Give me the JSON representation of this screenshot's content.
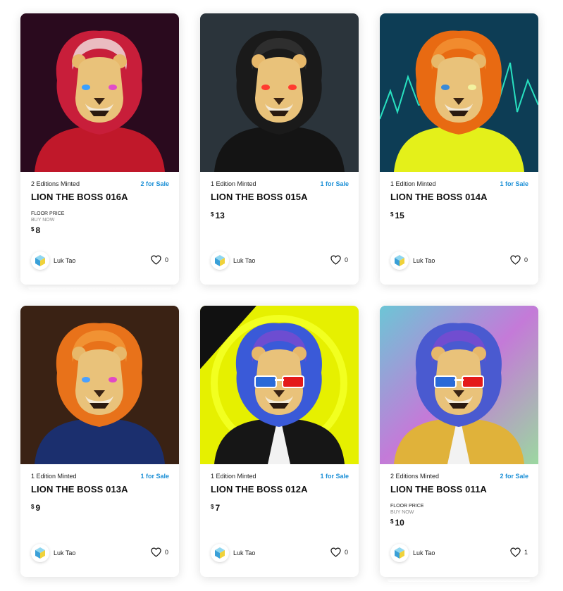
{
  "cards": [
    {
      "editions": "2 Editions Minted",
      "for_sale": "2 for Sale",
      "title": "LION THE BOSS 016A",
      "floor_label": "FLOOR PRICE",
      "buy_label": "BUY NOW",
      "currency": "$",
      "price": "8",
      "creator": "Luk Tao",
      "likes": "0",
      "theme": {
        "bg": "#2a0a1e",
        "mane": "#c81e3a",
        "mane2": "#f2e4e4",
        "suit": "#c0182a",
        "eyeL": "#3aa0ff",
        "eyeR": "#e14cc8"
      }
    },
    {
      "editions": "1 Edition Minted",
      "for_sale": "1 for Sale",
      "title": "LION THE BOSS 015A",
      "currency": "$",
      "price": "13",
      "creator": "Luk Tao",
      "likes": "0",
      "theme": {
        "bg": "#2b343b",
        "mane": "#1a1a1a",
        "mane2": "#333333",
        "suit": "#141414",
        "eyeL": "#ff3b2f",
        "eyeR": "#ff3b2f"
      }
    },
    {
      "editions": "1 Edition Minted",
      "for_sale": "1 for Sale",
      "title": "LION THE BOSS 014A",
      "currency": "$",
      "price": "15",
      "creator": "Luk Tao",
      "likes": "0",
      "theme": {
        "bg": "#0d3d55",
        "mane": "#e86a12",
        "mane2": "#f29436",
        "suit": "#e4f01a",
        "eyeL": "#3a8ad8",
        "eyeR": "#f2f2a0"
      }
    },
    {
      "editions": "1 Edition Minted",
      "for_sale": "1 for Sale",
      "title": "LION THE BOSS 013A",
      "currency": "$",
      "price": "9",
      "creator": "Luk Tao",
      "likes": "0",
      "theme": {
        "bg": "#3a2214",
        "mane": "#e8721a",
        "mane2": "#f39a3a",
        "suit": "#1b2f6e",
        "eyeL": "#4aa0ff",
        "eyeR": "#e148c6"
      }
    },
    {
      "editions": "1 Edition Minted",
      "for_sale": "1 for Sale",
      "title": "LION THE BOSS 012A",
      "currency": "$",
      "price": "7",
      "creator": "Luk Tao",
      "likes": "0",
      "theme": {
        "bg": "#e6f000",
        "mane": "#3a5ad8",
        "mane2": "#7a4ad0",
        "suit": "#161616",
        "eyeL": "#2a6ad8",
        "eyeR": "#e41a1a"
      }
    },
    {
      "editions": "2 Editions Minted",
      "for_sale": "2 for Sale",
      "title": "LION THE BOSS 011A",
      "floor_label": "FLOOR PRICE",
      "buy_label": "BUY NOW",
      "currency": "$",
      "price": "10",
      "creator": "Luk Tao",
      "likes": "1",
      "theme": {
        "bg": "#7ab8c8",
        "mane": "#4a5ad0",
        "mane2": "#7a4ad0",
        "suit": "#e0b23a",
        "eyeL": "#2a6ad8",
        "eyeR": "#e41a1a"
      }
    }
  ]
}
